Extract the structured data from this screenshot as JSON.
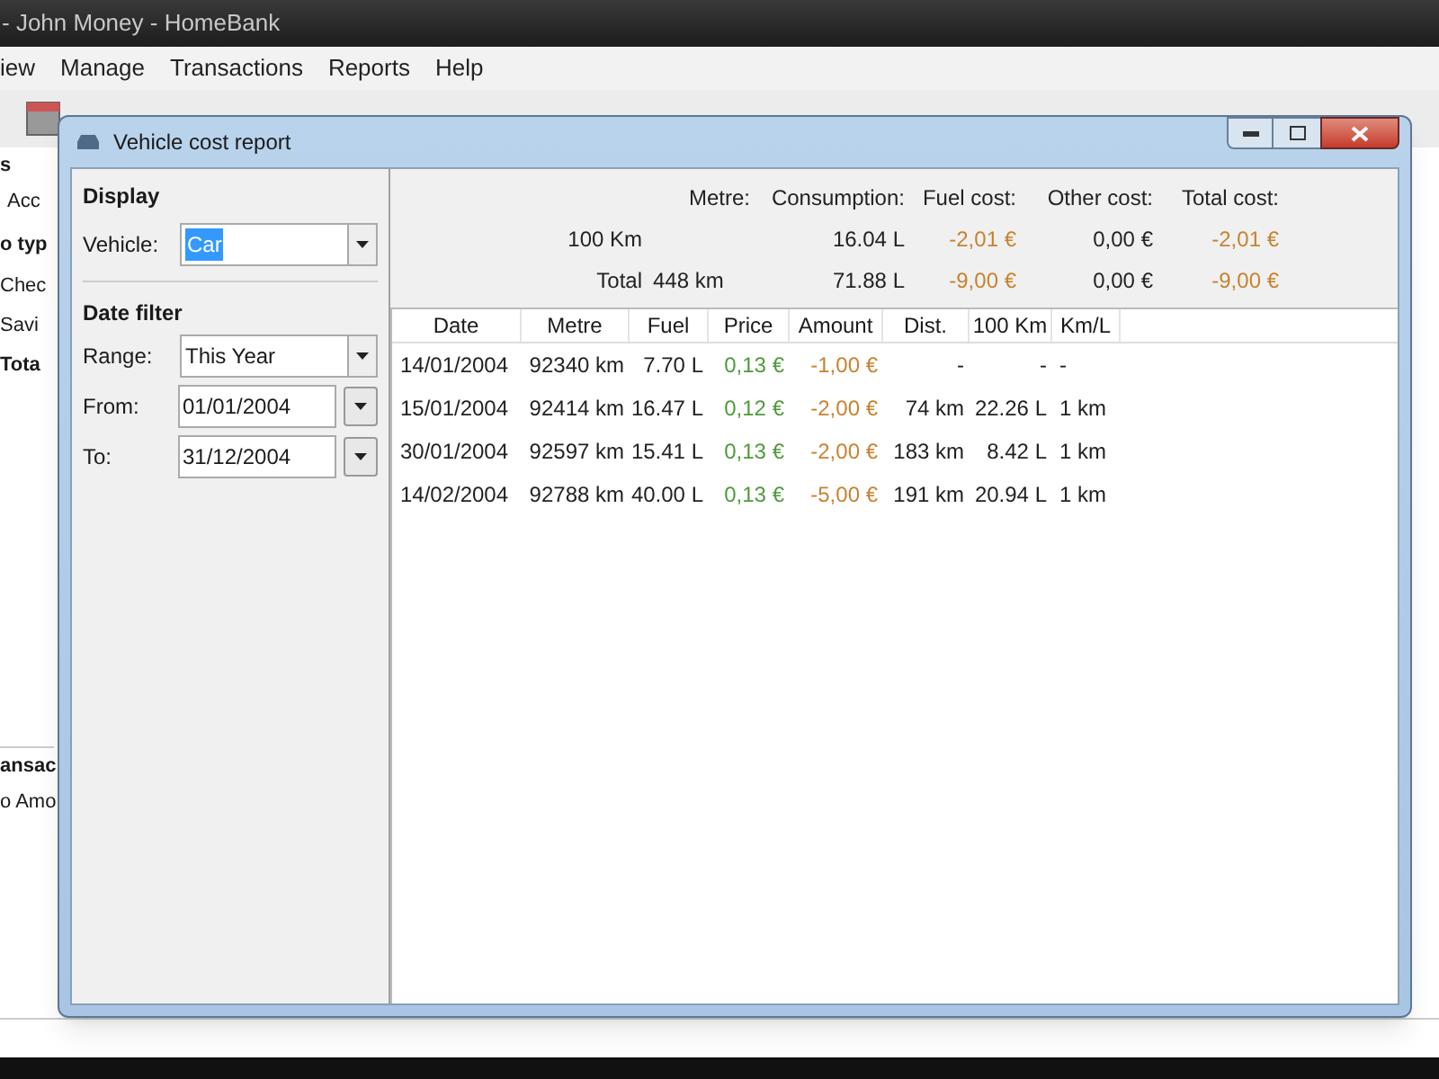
{
  "main_window": {
    "title": "- John Money - HomeBank",
    "menu": [
      "iew",
      "Manage",
      "Transactions",
      "Reports",
      "Help"
    ],
    "sidebar_texts": [
      {
        "text": "s",
        "bold": true
      },
      {
        "text": "Acc",
        "bold": false
      },
      {
        "text": "o typ",
        "bold": true
      },
      {
        "text": "Chec",
        "bold": false
      },
      {
        "text": "Savi",
        "bold": false
      },
      {
        "text": "Tota",
        "bold": true
      }
    ],
    "bottom_texts": [
      {
        "text": "ansac",
        "bold": true
      },
      {
        "text": "o Amo",
        "bold": false
      }
    ]
  },
  "dialog": {
    "title": "Vehicle cost report",
    "display": {
      "heading": "Display",
      "vehicle_label": "Vehicle:",
      "vehicle_value": "Car",
      "text_selected": true
    },
    "date_filter": {
      "heading": "Date filter",
      "fields": [
        {
          "label": "Range:",
          "value": "This Year",
          "kind": "combo"
        },
        {
          "label": "From:",
          "value": "01/01/2004",
          "kind": "date"
        },
        {
          "label": "To:",
          "value": "31/12/2004",
          "kind": "date"
        }
      ]
    },
    "summary": {
      "columns": [
        {
          "kind": "plain"
        },
        {
          "label": "Metre:",
          "kind": "plain"
        },
        {
          "label": "Consumption:",
          "kind": "plain"
        },
        {
          "label": "Fuel cost:",
          "kind": "negative"
        },
        {
          "label": "Other cost:",
          "kind": "plain"
        },
        {
          "label": "Total cost:",
          "kind": "negative"
        }
      ],
      "rows": [
        [
          "100 Km",
          "",
          "16.04 L",
          "-2,01 €",
          "0,00 €",
          "-2,01 €"
        ],
        [
          "Total",
          "448 km",
          "71.88 L",
          "-9,00 €",
          "0,00 €",
          "-9,00 €"
        ]
      ]
    },
    "table": {
      "columns": [
        {
          "label": "Date",
          "kind": "plain"
        },
        {
          "label": "Metre",
          "kind": "plain"
        },
        {
          "label": "Fuel",
          "kind": "plain"
        },
        {
          "label": "Price",
          "kind": "positive"
        },
        {
          "label": "Amount",
          "kind": "negative"
        },
        {
          "label": "Dist.",
          "kind": "plain"
        },
        {
          "label": "100 Km",
          "kind": "plain"
        },
        {
          "label": "Km/L",
          "kind": "plain"
        }
      ],
      "rows": [
        [
          "14/01/2004",
          "92340 km",
          "7.70 L",
          "0,13 €",
          "-1,00 €",
          "-",
          "-",
          "-"
        ],
        [
          "15/01/2004",
          "92414 km",
          "16.47 L",
          "0,12 €",
          "-2,00 €",
          "74 km",
          "22.26 L",
          "1 km"
        ],
        [
          "30/01/2004",
          "92597 km",
          "15.41 L",
          "0,13 €",
          "-2,00 €",
          "183 km",
          "8.42 L",
          "1 km"
        ],
        [
          "14/02/2004",
          "92788 km",
          "40.00 L",
          "0,13 €",
          "-5,00 €",
          "191 km",
          "20.94 L",
          "1 km"
        ]
      ]
    }
  }
}
